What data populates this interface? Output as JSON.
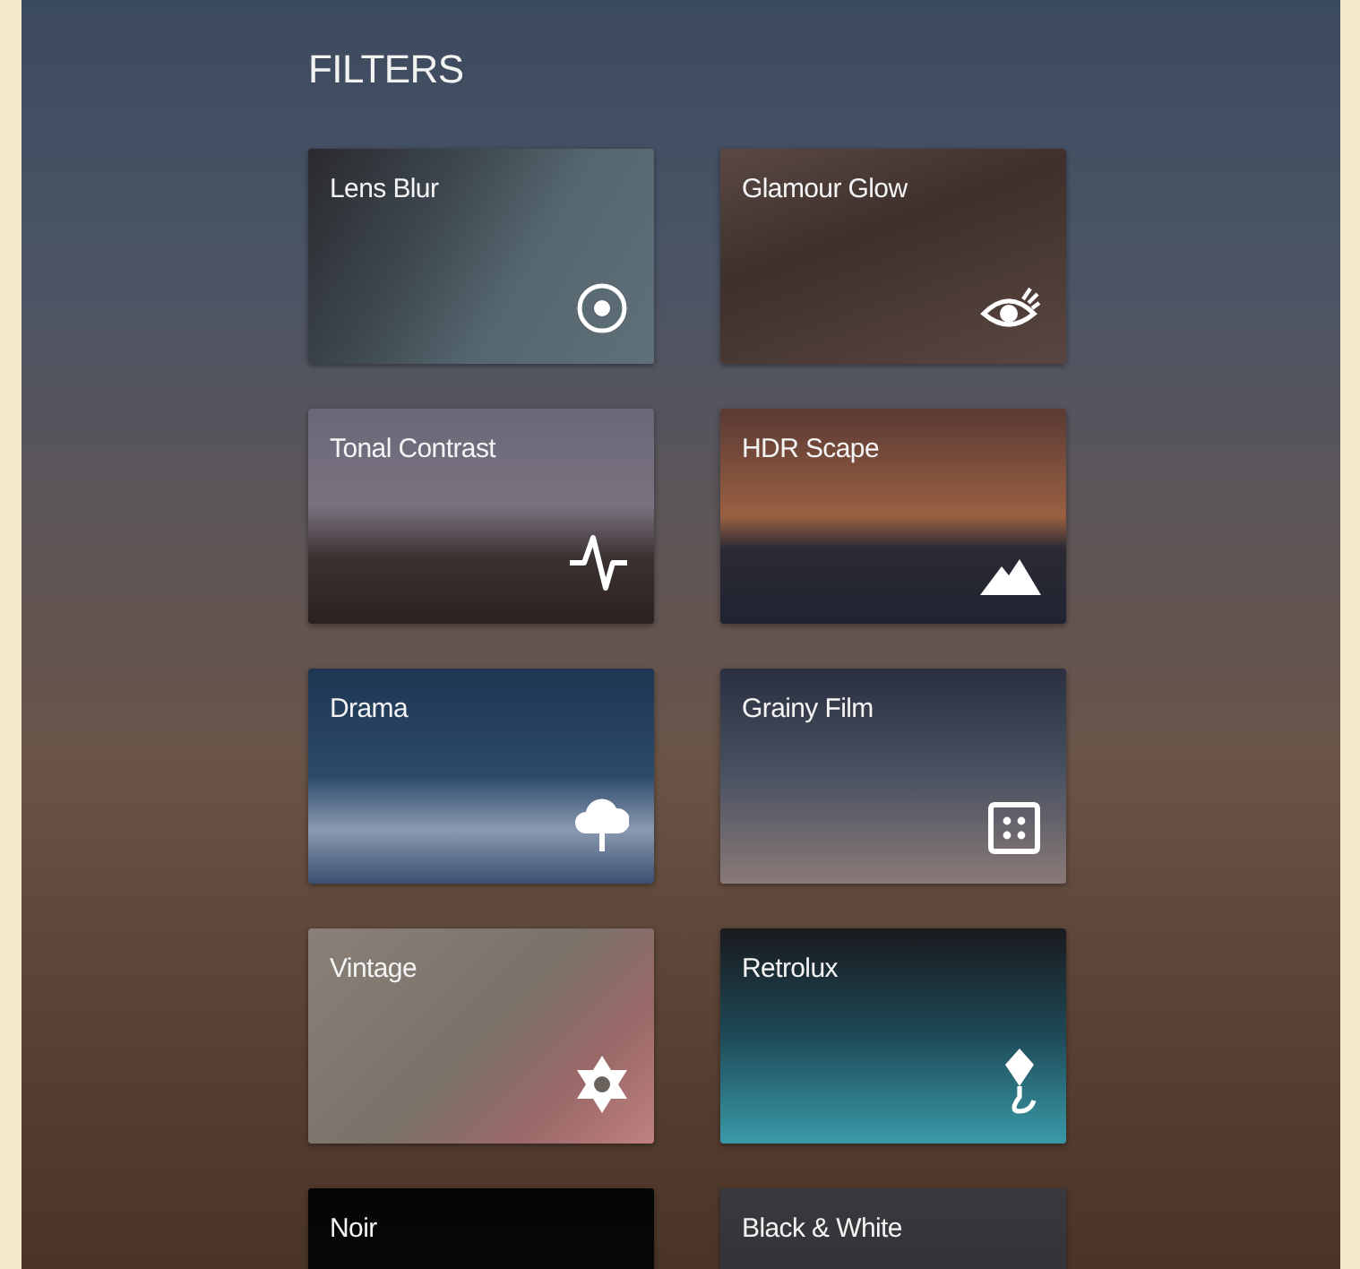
{
  "title": "FILTERS",
  "filters": [
    {
      "label": "Lens Blur"
    },
    {
      "label": "Glamour Glow"
    },
    {
      "label": "Tonal Contrast"
    },
    {
      "label": "HDR Scape"
    },
    {
      "label": "Drama"
    },
    {
      "label": "Grainy Film"
    },
    {
      "label": "Vintage"
    },
    {
      "label": "Retrolux"
    },
    {
      "label": "Noir"
    },
    {
      "label": "Black & White"
    }
  ]
}
